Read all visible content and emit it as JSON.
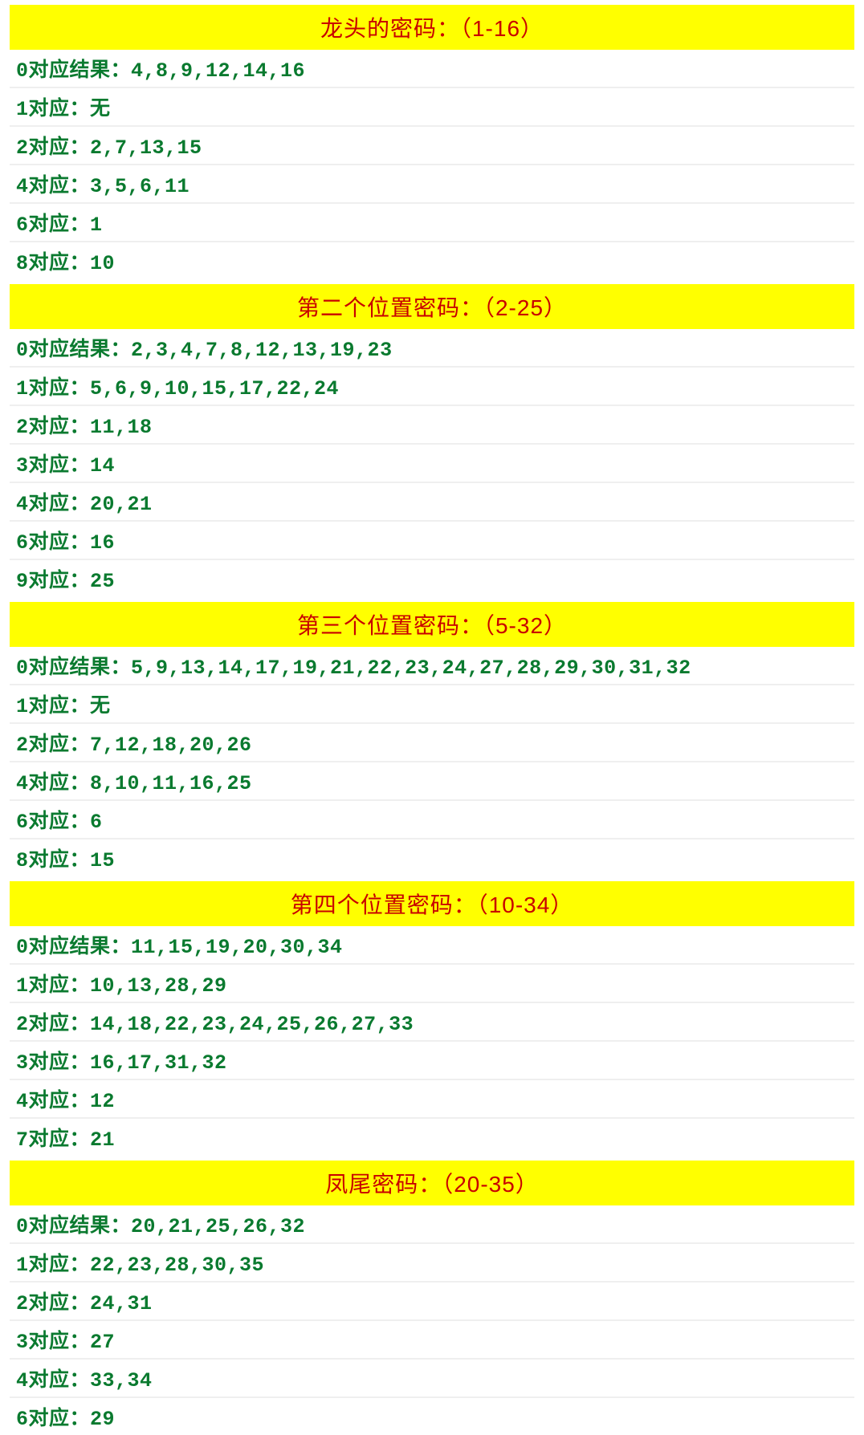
{
  "sections": [
    {
      "title": "龙头的密码：（1-16）",
      "rows": [
        {
          "label": "0对应结果：",
          "values": "4,8,9,12,14,16"
        },
        {
          "label": "1对应：",
          "values": "无"
        },
        {
          "label": "2对应：",
          "values": "2,7,13,15"
        },
        {
          "label": "4对应：",
          "values": "3,5,6,11"
        },
        {
          "label": "6对应：",
          "values": "1"
        },
        {
          "label": "8对应：",
          "values": "10"
        }
      ]
    },
    {
      "title": "第二个位置密码：（2-25）",
      "rows": [
        {
          "label": "0对应结果：",
          "values": "2,3,4,7,8,12,13,19,23"
        },
        {
          "label": "1对应：",
          "values": "5,6,9,10,15,17,22,24"
        },
        {
          "label": "2对应：",
          "values": "11,18"
        },
        {
          "label": "3对应：",
          "values": "14"
        },
        {
          "label": "4对应：",
          "values": "20,21"
        },
        {
          "label": "6对应：",
          "values": "16"
        },
        {
          "label": "9对应：",
          "values": "25"
        }
      ]
    },
    {
      "title": "第三个位置密码：（5-32）",
      "rows": [
        {
          "label": "0对应结果：",
          "values": "5,9,13,14,17,19,21,22,23,24,27,28,29,30,31,32"
        },
        {
          "label": "1对应：",
          "values": "无"
        },
        {
          "label": "2对应：",
          "values": "7,12,18,20,26"
        },
        {
          "label": "4对应：",
          "values": "8,10,11,16,25"
        },
        {
          "label": "6对应：",
          "values": "6"
        },
        {
          "label": "8对应：",
          "values": "15"
        }
      ]
    },
    {
      "title": "第四个位置密码：（10-34）",
      "rows": [
        {
          "label": "0对应结果：",
          "values": "11,15,19,20,30,34"
        },
        {
          "label": "1对应：",
          "values": "10,13,28,29"
        },
        {
          "label": "2对应：",
          "values": "14,18,22,23,24,25,26,27,33"
        },
        {
          "label": "3对应：",
          "values": "16,17,31,32"
        },
        {
          "label": "4对应：",
          "values": "12"
        },
        {
          "label": "7对应：",
          "values": "21"
        }
      ]
    },
    {
      "title": "凤尾密码：（20-35）",
      "rows": [
        {
          "label": "0对应结果：",
          "values": "20,21,25,26,32"
        },
        {
          "label": "1对应：",
          "values": "22,23,28,30,35"
        },
        {
          "label": "2对应：",
          "values": "24,31"
        },
        {
          "label": "3对应：",
          "values": "27"
        },
        {
          "label": "4对应：",
          "values": "33,34"
        },
        {
          "label": "6对应：",
          "values": "29"
        }
      ]
    }
  ]
}
